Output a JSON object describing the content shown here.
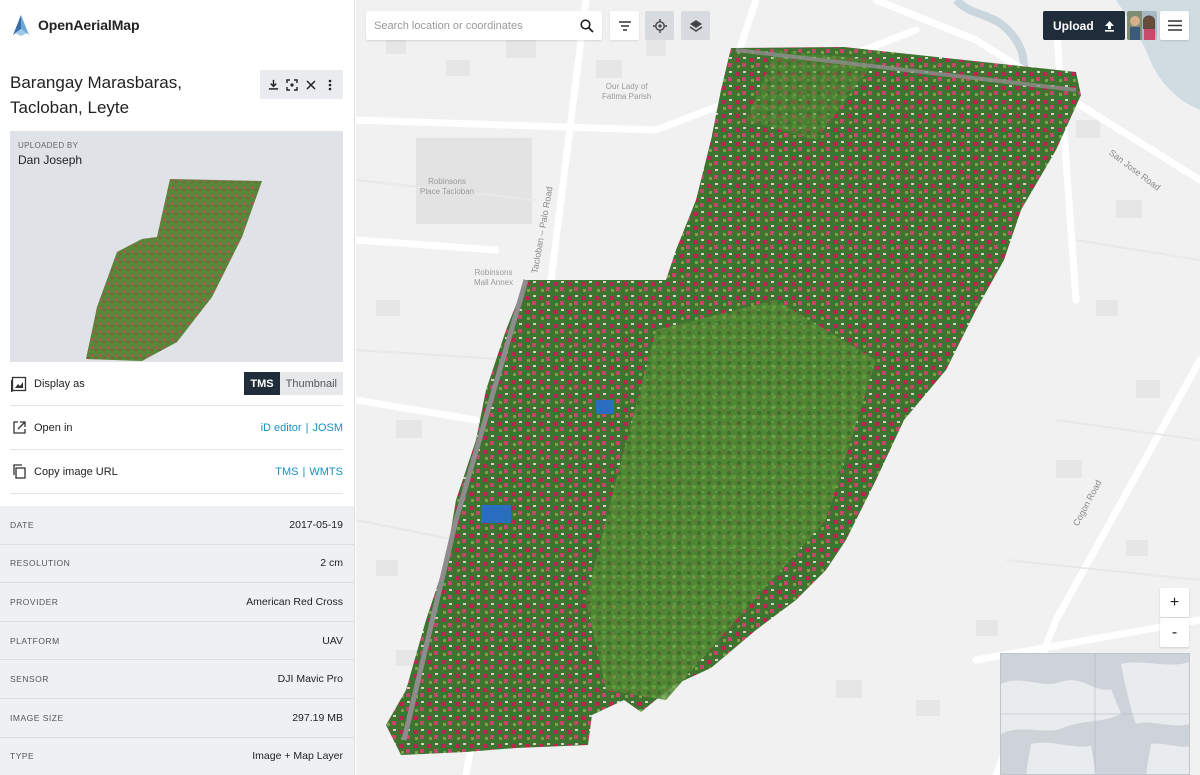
{
  "app": {
    "brand": "OpenAerialMap"
  },
  "image": {
    "title": "Barangay Marasbaras, Tacloban, Leyte",
    "uploaded_by_label": "UPLOADED BY",
    "uploader": "Dan Joseph"
  },
  "title_tools": {
    "download_icon": "download-icon",
    "fullscreen_icon": "focus-icon",
    "close_icon": "close-icon",
    "more_icon": "more-vertical-icon"
  },
  "actions": {
    "display_as": {
      "label": "Display as",
      "icon": "image-icon",
      "options": [
        "TMS",
        "Thumbnail"
      ],
      "selected": "TMS"
    },
    "open_in": {
      "label": "Open in",
      "icon": "external-link-icon",
      "links": [
        "iD editor",
        "JOSM"
      ],
      "separator": "|"
    },
    "copy_url": {
      "label": "Copy image URL",
      "icon": "copy-icon",
      "links": [
        "TMS",
        "WMTS"
      ],
      "separator": "|"
    }
  },
  "metadata": [
    {
      "key": "DATE",
      "value": "2017-05-19"
    },
    {
      "key": "RESOLUTION",
      "value": "2 cm"
    },
    {
      "key": "PROVIDER",
      "value": "American Red Cross"
    },
    {
      "key": "PLATFORM",
      "value": "UAV"
    },
    {
      "key": "SENSOR",
      "value": "DJI Mavic Pro"
    },
    {
      "key": "IMAGE SIZE",
      "value": "297.19 MB"
    },
    {
      "key": "TYPE",
      "value": "Image + Map Layer"
    }
  ],
  "map": {
    "search_placeholder": "Search location or coordinates",
    "upload_label": "Upload",
    "zoom_in": "+",
    "zoom_out": "-",
    "labels": {
      "church": "Our Lady of\nFatima Parish",
      "robinsons": "Robinsons\nPlace Tacloban",
      "robinsons_annex": "Robinsons\nMall Annex",
      "palo_road": "Tacloban – Palo Road",
      "san_jose_road": "San Jose Road",
      "cogon_road": "Cogon Road"
    }
  },
  "colors": {
    "accent_dark": "#1f2d3a",
    "link": "#1a8fc1",
    "meta_bg": "#eef0f2"
  }
}
